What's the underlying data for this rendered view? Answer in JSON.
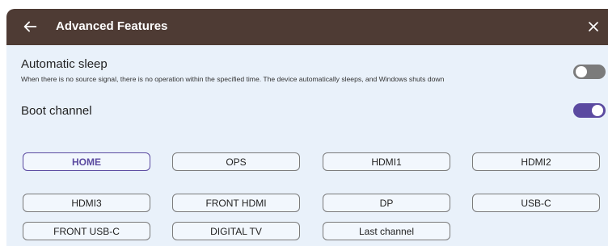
{
  "header": {
    "title": "Advanced Features",
    "back_icon": "arrow-left-icon",
    "close_icon": "close-icon"
  },
  "automatic_sleep": {
    "label": "Automatic sleep",
    "description": "When there is no source signal, there is no operation within the specified time. The device automatically sleeps, and Windows shuts down",
    "enabled": false
  },
  "boot_channel": {
    "label": "Boot channel",
    "enabled": true,
    "selected": "HOME",
    "channels": [
      "HOME",
      "OPS",
      "HDMI1",
      "HDMI2",
      "HDMI3",
      "FRONT HDMI",
      "DP",
      "USB-C",
      "FRONT USB-C",
      "DIGITAL TV",
      "Last channel"
    ]
  },
  "colors": {
    "titlebar": "#4e3b34",
    "background": "#e9f1fa",
    "accent": "#5b4aa0",
    "toggle_off": "#7b7b7b"
  }
}
